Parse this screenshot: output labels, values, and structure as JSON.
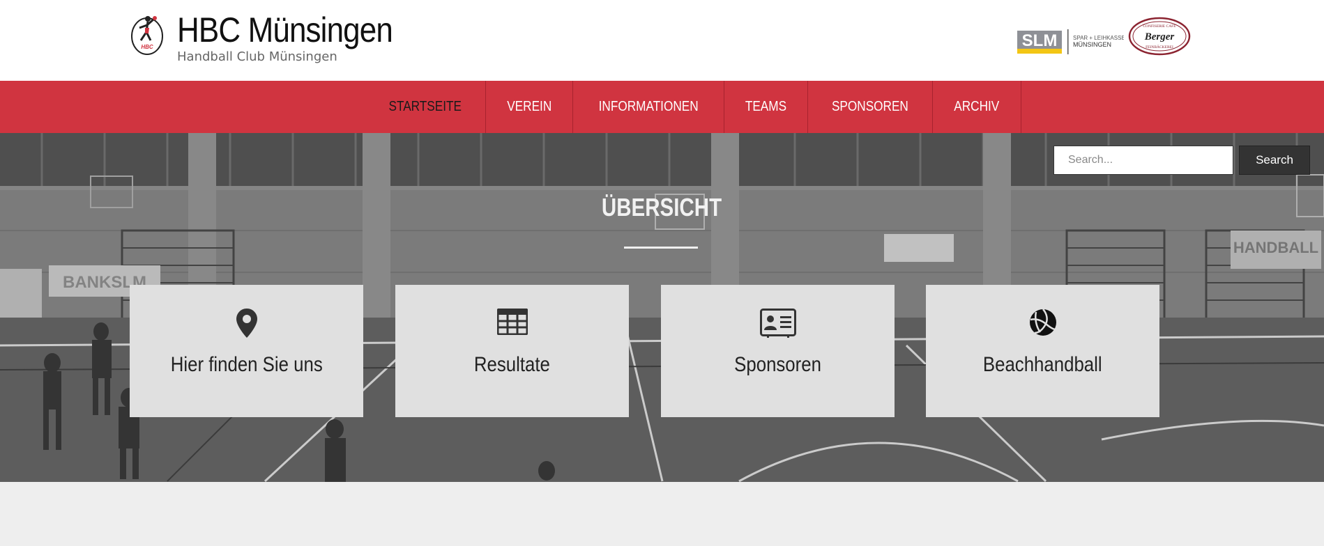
{
  "header": {
    "site_title": "HBC Münsingen",
    "site_tagline": "Handball Club Münsingen",
    "logo_icon": "handball-player-logo",
    "sponsors": [
      {
        "name": "SLM",
        "line1": "SPAR + LEIHKASSE",
        "line2": "MÜNSINGEN"
      },
      {
        "name": "Berger",
        "line1": "CONFISERIE CAFÉ",
        "line2": "FEINBÄCKEREI"
      }
    ]
  },
  "nav": {
    "items": [
      {
        "label": "STARTSEITE",
        "active": true
      },
      {
        "label": "VEREIN",
        "active": false
      },
      {
        "label": "INFORMATIONEN",
        "active": false
      },
      {
        "label": "TEAMS",
        "active": false
      },
      {
        "label": "SPONSOREN",
        "active": false
      },
      {
        "label": "ARCHIV",
        "active": false
      }
    ]
  },
  "search": {
    "placeholder": "Search...",
    "button_label": "Search"
  },
  "hero": {
    "title": "ÜBERSICHT",
    "banner_text": "BANKSLM",
    "sign_text": "HANDBALL"
  },
  "cards": [
    {
      "label": "Hier finden Sie uns",
      "icon": "map-marker-icon"
    },
    {
      "label": "Resultate",
      "icon": "table-icon"
    },
    {
      "label": "Sponsoren",
      "icon": "id-card-icon"
    },
    {
      "label": "Beachhandball",
      "icon": "volleyball-icon"
    }
  ],
  "colors": {
    "nav_bg": "#d03440",
    "card_bg": "#e0e0e0",
    "search_button_bg": "#333333"
  }
}
